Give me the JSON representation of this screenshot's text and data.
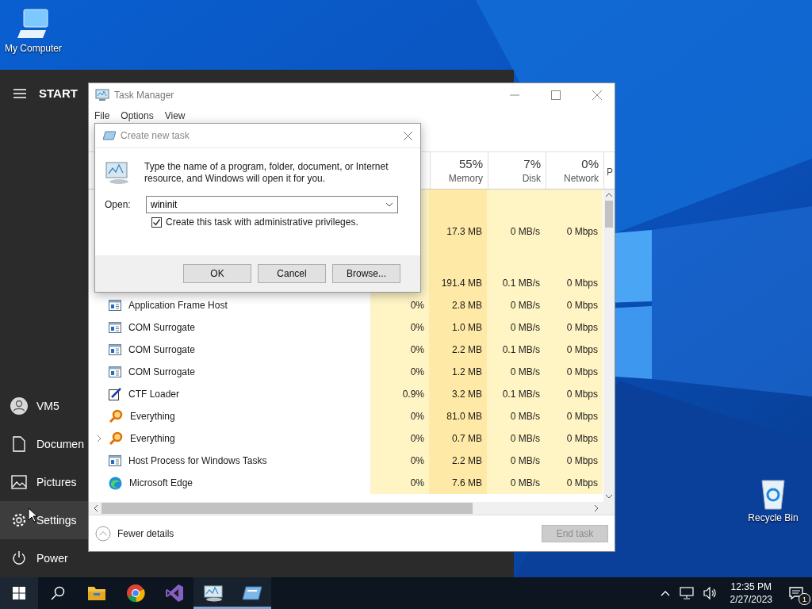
{
  "desktop_icons": [
    {
      "kind": "computer",
      "label": "My Computer"
    },
    {
      "kind": "recycle",
      "label": "Recycle Bin"
    }
  ],
  "start_menu": {
    "title": "START",
    "items": [
      {
        "kind": "user",
        "label": "VM5",
        "hovered": false
      },
      {
        "kind": "document",
        "label": "Documen",
        "hovered": false
      },
      {
        "kind": "pictures",
        "label": "Pictures",
        "hovered": false
      },
      {
        "kind": "settings",
        "label": "Settings",
        "hovered": true
      },
      {
        "kind": "power",
        "label": "Power",
        "hovered": false
      }
    ]
  },
  "task_manager": {
    "title": "Task Manager",
    "menu": [
      "File",
      "Options",
      "View"
    ],
    "columns": [
      {
        "percent": "55%",
        "label": "Memory"
      },
      {
        "percent": "7%",
        "label": "Disk"
      },
      {
        "percent": "0%",
        "label": "Network"
      },
      {
        "label": "P"
      }
    ],
    "rows": [
      {
        "kind": "group"
      },
      {
        "kind": "covered",
        "memory": "17.3 MB",
        "disk": "0 MB/s",
        "network": "0 Mbps"
      },
      {
        "kind": "group"
      },
      {
        "kind": "covered",
        "memory": "191.4 MB",
        "disk": "0.1 MB/s",
        "network": "0 Mbps"
      },
      {
        "kind": "service",
        "name": "Application Frame Host",
        "cpu": "0%",
        "memory": "2.8 MB",
        "disk": "0 MB/s",
        "network": "0 Mbps",
        "expandable": false
      },
      {
        "kind": "service",
        "name": "COM Surrogate",
        "cpu": "0%",
        "memory": "1.0 MB",
        "disk": "0 MB/s",
        "network": "0 Mbps",
        "expandable": false
      },
      {
        "kind": "service",
        "name": "COM Surrogate",
        "cpu": "0%",
        "memory": "2.2 MB",
        "disk": "0.1 MB/s",
        "network": "0 Mbps",
        "expandable": false
      },
      {
        "kind": "service",
        "name": "COM Surrogate",
        "cpu": "0%",
        "memory": "1.2 MB",
        "disk": "0 MB/s",
        "network": "0 Mbps",
        "expandable": false
      },
      {
        "kind": "editor",
        "name": "CTF Loader",
        "cpu": "0.9%",
        "memory": "3.2 MB",
        "disk": "0.1 MB/s",
        "network": "0 Mbps",
        "expandable": false
      },
      {
        "kind": "search",
        "name": "Everything",
        "cpu": "0%",
        "memory": "81.0 MB",
        "disk": "0 MB/s",
        "network": "0 Mbps",
        "expandable": false
      },
      {
        "kind": "search",
        "name": "Everything",
        "cpu": "0%",
        "memory": "0.7 MB",
        "disk": "0 MB/s",
        "network": "0 Mbps",
        "expandable": true
      },
      {
        "kind": "service",
        "name": "Host Process for Windows Tasks",
        "cpu": "0%",
        "memory": "2.2 MB",
        "disk": "0 MB/s",
        "network": "0 Mbps",
        "expandable": false
      },
      {
        "kind": "browser",
        "name": "Microsoft Edge",
        "cpu": "0%",
        "memory": "7.6 MB",
        "disk": "0 MB/s",
        "network": "0 Mbps",
        "expandable": false
      }
    ],
    "fewer_details": "Fewer details",
    "end_task": {
      "label": "End task",
      "disabled": true
    }
  },
  "dialog": {
    "title": "Create new task",
    "message": "Type the name of a program, folder, document, or Internet resource, and Windows will open it for you.",
    "open_label": "Open:",
    "value": "wininit",
    "admin": {
      "label": "Create this task with administrative privileges.",
      "checked": true
    },
    "buttons": [
      "OK",
      "Cancel",
      "Browse..."
    ]
  },
  "taskbar": {
    "apps": [
      {
        "kind": "folder",
        "open": false
      },
      {
        "kind": "browser",
        "open": false
      },
      {
        "kind": "studio",
        "open": false
      },
      {
        "kind": "monitor",
        "open": true
      },
      {
        "kind": "run",
        "open": true
      }
    ],
    "time": "12:35 PM",
    "date": "2/27/2023",
    "notifications": "1"
  }
}
